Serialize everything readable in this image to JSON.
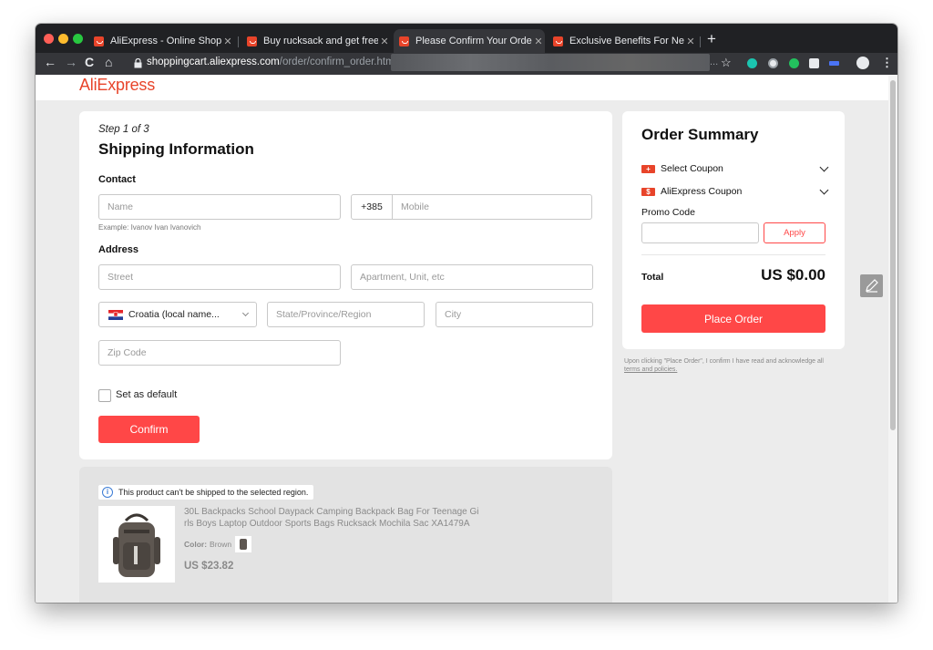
{
  "browser": {
    "tabs": [
      {
        "title": "AliExpress - Online Shopping f",
        "active": false
      },
      {
        "title": "Buy rucksack and get free ship",
        "active": false
      },
      {
        "title": "Please Confirm Your Order - Al",
        "active": true
      },
      {
        "title": "Exclusive Benefits For Newcom",
        "active": false
      }
    ],
    "new_tab": "+",
    "url_host": "shoppingcart.aliexpress.com",
    "url_path": "/order/confirm_order.htm?obj",
    "url_suffix": "..."
  },
  "page": {
    "logo": "AliExpress",
    "shipping": {
      "step": "Step 1 of 3",
      "title": "Shipping Information",
      "contact_label": "Contact",
      "name_placeholder": "Name",
      "name_hint": "Example: Ivanov Ivan Ivanovich",
      "phone_code": "+385",
      "mobile_placeholder": "Mobile",
      "address_label": "Address",
      "street_placeholder": "Street",
      "apartment_placeholder": "Apartment, Unit, etc",
      "country": "Croatia (local name...",
      "state_placeholder": "State/Province/Region",
      "city_placeholder": "City",
      "zip_placeholder": "Zip Code",
      "default_label": "Set as default",
      "confirm_label": "Confirm"
    },
    "product": {
      "notice": "This product can't be shipped to the selected region.",
      "title_line1": "30L Backpacks School Daypack Camping Backpack Bag For Teenage Gi",
      "title_line2": "rls Boys Laptop Outdoor Sports Bags Rucksack Mochila Sac XA1479A",
      "color_label": "Color:",
      "color_value": "Brown",
      "price": "US $23.82"
    },
    "summary": {
      "title": "Order Summary",
      "select_coupon": "Select Coupon",
      "ali_coupon": "AliExpress Coupon",
      "promo_label": "Promo Code",
      "apply_label": "Apply",
      "total_label": "Total",
      "total_value": "US $0.00",
      "place_order": "Place Order",
      "disclaimer": "Upon clicking \"Place Order\", I confirm I have read and acknowledge all",
      "terms_link": "terms and policies."
    }
  },
  "colors": {
    "brand": "#e8442a",
    "button_red": "#ff4747",
    "tab_bar": "#202124",
    "toolbar": "#35363a",
    "page_bg": "#ececec"
  }
}
